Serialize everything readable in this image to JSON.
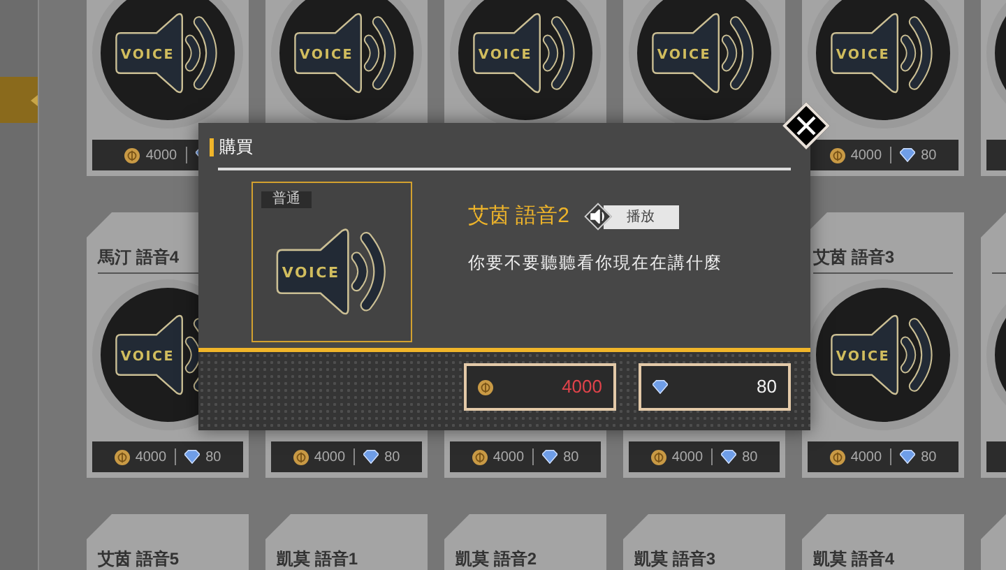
{
  "card_rows": [
    [
      {
        "icon": true,
        "icon_text": "VOICE",
        "coin": "4000"
      },
      {
        "icon": true,
        "icon_text": "VOICE"
      },
      {
        "icon": true,
        "icon_text": "VOICE"
      },
      {
        "icon": true,
        "icon_text": "VOICE"
      },
      {
        "icon": true,
        "icon_text": "VOICE",
        "coin": "4000",
        "gem": "80"
      },
      {
        "icon": true
      }
    ],
    [
      {
        "title": "馬汀 語音4",
        "icon": true,
        "icon_text": "VOICE",
        "coin": "4000",
        "gem": "80"
      },
      {
        "icon": false,
        "coin": "4000",
        "gem": "80"
      },
      {
        "icon": false,
        "coin": "4000",
        "gem": "80"
      },
      {
        "icon": false,
        "coin": "4000",
        "gem": "80"
      },
      {
        "title": "艾茵 語音3",
        "icon": true,
        "icon_text": "VOICE",
        "coin": "4000",
        "gem": "80"
      },
      {
        "icon": true
      }
    ],
    [
      {
        "title": "艾茵 語音5",
        "icon": false
      },
      {
        "title": "凱莫 語音1",
        "icon": false
      },
      {
        "title": "凱莫 語音2",
        "icon": false
      },
      {
        "title": "凱莫 語音3",
        "icon": false
      },
      {
        "title": "凱莫 語音4",
        "icon": false
      },
      {
        "icon": false
      }
    ]
  ],
  "dialog": {
    "title": "購買",
    "item": {
      "rarity": "普通",
      "icon_text": "VOICE",
      "name": "艾茵 語音2",
      "play_button": "播放",
      "description": "你要不要聽聽看你現在在講什麼"
    },
    "prices": [
      {
        "kind": "coin",
        "amount": "4000",
        "affordable": false
      },
      {
        "kind": "gem",
        "amount": "80",
        "affordable": true
      }
    ]
  }
}
